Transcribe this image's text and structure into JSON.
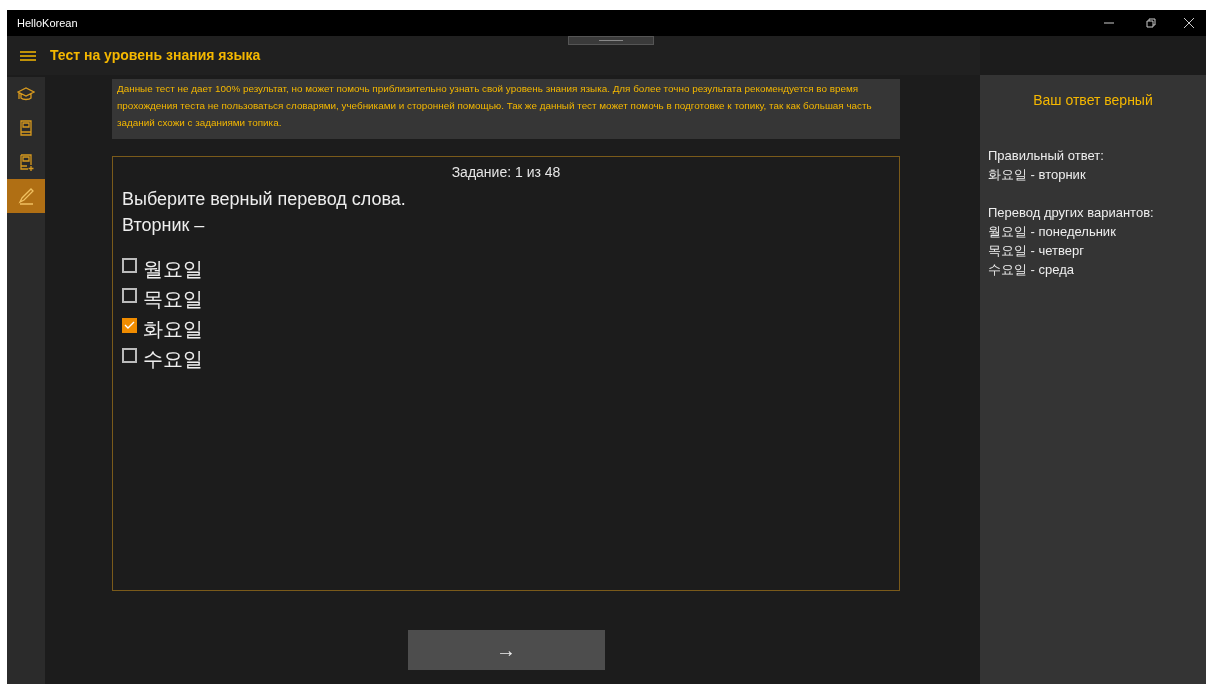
{
  "window": {
    "title": "HelloKorean"
  },
  "header": {
    "title": "Тест на уровень знания языка"
  },
  "sidebar": {
    "items": [
      {
        "kind": "cap",
        "selected": false
      },
      {
        "kind": "book",
        "selected": false
      },
      {
        "kind": "bookadd",
        "selected": false
      },
      {
        "kind": "pencil",
        "selected": true
      }
    ]
  },
  "notice": "Данные тест не дает 100% результат, но может помочь приблизительно узнать свой уровень знания языка. Для более точно результата рекомендуется во время прохождения теста не пользоваться словарями, учебниками и сторонней помощью. Так же данный тест может помочь в подготовке к топику, так как большая часть заданий схожи с заданиями топика.",
  "task": {
    "counter": "Задание: 1 из 48",
    "question": "Выберите верный перевод слова.",
    "word": "Вторник –",
    "options": [
      {
        "label": "월요일",
        "checked": false
      },
      {
        "label": "목요일",
        "checked": false
      },
      {
        "label": "화요일",
        "checked": true
      },
      {
        "label": "수요일",
        "checked": false
      }
    ]
  },
  "next_button": "→",
  "result": {
    "verdict": "Ваш ответ верный",
    "correct_heading": "Правильный ответ:",
    "correct": "화요일 - вторник",
    "others_heading": "Перевод других вариантов:",
    "others": [
      "월요일 - понедельник",
      "목요일 - четверг",
      "수요일 - среда"
    ]
  }
}
